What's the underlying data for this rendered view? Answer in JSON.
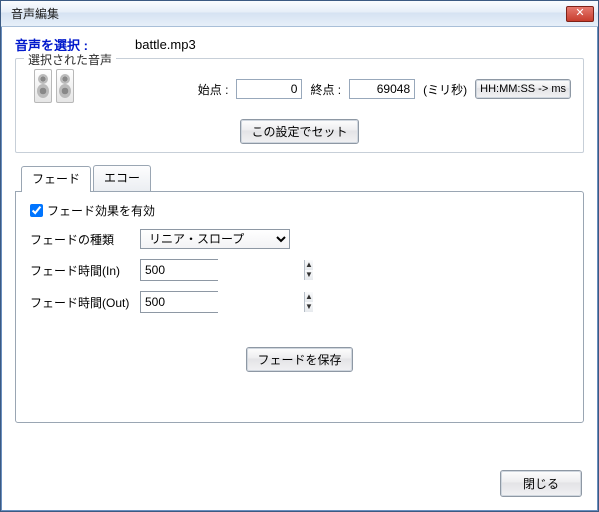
{
  "window": {
    "title": "音声編集"
  },
  "select": {
    "label": "音声を選択 :",
    "file": "battle.mp3"
  },
  "group": {
    "legend": "選択された音声"
  },
  "params": {
    "start_label": "始点 :",
    "start_value": "0",
    "end_label": "終点 :",
    "end_value": "69048",
    "unit": "(ミリ秒)",
    "convert_btn": "HH:MM:SS -> ms",
    "set_btn": "この設定でセット"
  },
  "tabs": {
    "fade": "フェード",
    "echo": "エコー"
  },
  "fade": {
    "enable_label": "フェード効果を有効",
    "type_label": "フェードの種類",
    "type_value": "リニア・スロープ",
    "in_label": "フェード時間(In)",
    "in_value": "500",
    "out_label": "フェード時間(Out)",
    "out_value": "500",
    "save_btn": "フェードを保存"
  },
  "footer": {
    "close": "閉じる"
  }
}
